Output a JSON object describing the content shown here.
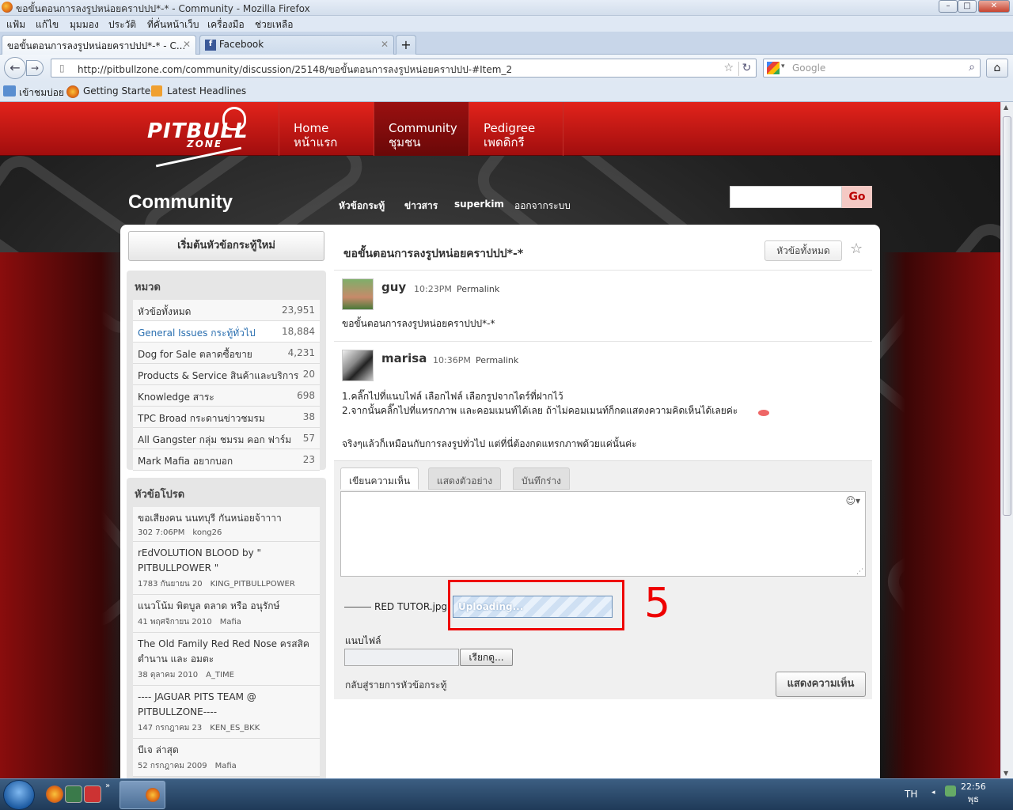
{
  "window": {
    "title": "ขอขั้นตอนการลงรูปหน่อยคราปปป*-* - Community - Mozilla Firefox"
  },
  "menu": [
    "แฟ้ม",
    "แก้ไข",
    "มุมมอง",
    "ประวัติ",
    "ที่คั่นหน้าเว็บ",
    "เครื่องมือ",
    "ช่วยเหลือ"
  ],
  "tabs": [
    {
      "label": "ขอขั้นตอนการลงรูปหน่อยคราปปป*-* - C..."
    },
    {
      "label": "Facebook"
    }
  ],
  "url": "http://pitbullzone.com/community/discussion/25148/ขอขั้นตอนการลงรูปหน่อยคราปปป-#Item_2",
  "search": {
    "placeholder": "Google"
  },
  "bookmarks": [
    "เข้าชมบ่อย",
    "Getting Started",
    "Latest Headlines"
  ],
  "site": {
    "logo": "PITBULL",
    "logo_sub": "ZONE",
    "nav": [
      {
        "en": "Home",
        "th": "หน้าแรก"
      },
      {
        "en": "Community",
        "th": "ชุมชน"
      },
      {
        "en": "Pedigree",
        "th": "เพดดิกรี"
      }
    ],
    "title": "Community",
    "sublinks": [
      "หัวข้อกระทู้",
      "ข่าวสาร",
      "superkim",
      "ออกจากระบบ"
    ],
    "go": "Go"
  },
  "sidebar": {
    "start_button": "เริ่มต้นหัวข้อกระทู้ใหม่",
    "cat_heading": "หมวด",
    "categories": [
      {
        "name": "หัวข้อทั้งหมด",
        "count": "23,951"
      },
      {
        "name": "General Issues กระทู้ทั่วไป",
        "count": "18,884"
      },
      {
        "name": "Dog for Sale ตลาดซื้อขาย",
        "count": "4,231"
      },
      {
        "name": "Products & Service สินค้าและบริการ",
        "count": "20"
      },
      {
        "name": "Knowledge สาระ",
        "count": "698"
      },
      {
        "name": "TPC Broad กระดานข่าวชมรม",
        "count": "38"
      },
      {
        "name": "All Gangster กลุ่ม ชมรม คอก ฟาร์ม",
        "count": "57"
      },
      {
        "name": "Mark Mafia อยากบอก",
        "count": "23"
      }
    ],
    "fav_heading": "หัวข้อโปรด",
    "favorites": [
      {
        "title": "ขอเสียงคน นนทบุรี กันหน่อยจ้าาาา",
        "meta": "302  7:06PM",
        "user": "kong26"
      },
      {
        "title": "rEdVOLUTION BLOOD by \" PITBULLPOWER \"",
        "meta": "1783  กันยายน 20",
        "user": "KING_PITBULLPOWER"
      },
      {
        "title": "แนวโน้ม พิตบูล ตลาด หรือ อนุรักษ์",
        "meta": "41  พฤศจิกายน 2010",
        "user": "Mafia"
      },
      {
        "title": "The Old Family Red Red Nose ครสสิค ตำนาน และ อมตะ",
        "meta": "38  ตุลาคม 2010",
        "user": "A_TIME"
      },
      {
        "title": "---- JAGUAR PITS TEAM @ PITBULLZONE----",
        "meta": "147  กรกฎาคม 23",
        "user": "KEN_ES_BKK"
      },
      {
        "title": "บีเจ ล่าสุด",
        "meta": "52  กรกฎาคม 2009",
        "user": "Mafia"
      }
    ]
  },
  "thread": {
    "title": "ขอขั้นตอนการลงรูปหน่อยคราปปป*-*",
    "all_button": "หัวข้อทั้งหมด",
    "posts": [
      {
        "user": "guy",
        "time": "10:23PM",
        "permalink": "Permalink",
        "body": "ขอขั้นตอนการลงรูปหน่อยคราปปป*-*"
      },
      {
        "user": "marisa",
        "time": "10:36PM",
        "permalink": "Permalink",
        "line1": "1.คลิ๊กไปที่แนบไฟล์ เลือกไฟล์ เลือกรูปจากไดร์ที่ฝากไว้",
        "line2": "2.จากนั้นคลิ๊กไปที่แทรกภาพ และคอมเมนท์ได้เลย ถ้าไม่คอมเมนท์ก็กดแสดงความคิดเห็นได้เลยค่ะ",
        "line3": "จริงๆแล้วก็เหมือนกับการลงรูปทั่วไป แต่ที่นี่ต้องกดแทรกภาพด้วยแค่นั้นค่ะ"
      }
    ]
  },
  "editor": {
    "tabs": [
      "เขียนความเห็น",
      "แสดงตัวอย่าง",
      "บันทึกร่าง"
    ],
    "file_name": "RED TUTOR.jpg",
    "uploading": "Uploading...",
    "annotation": "5",
    "attach_label": "แนบไฟล์",
    "browse": "เรียกดู...",
    "back_link": "กลับสู่รายการหัวข้อกระทู้",
    "submit": "แสดงความเห็น"
  },
  "taskbar": {
    "lang": "TH",
    "time": "22:56",
    "day": "พุธ"
  },
  "colors": {
    "brand_red": "#d01a14",
    "upload_blue": "#6a8fb8"
  }
}
